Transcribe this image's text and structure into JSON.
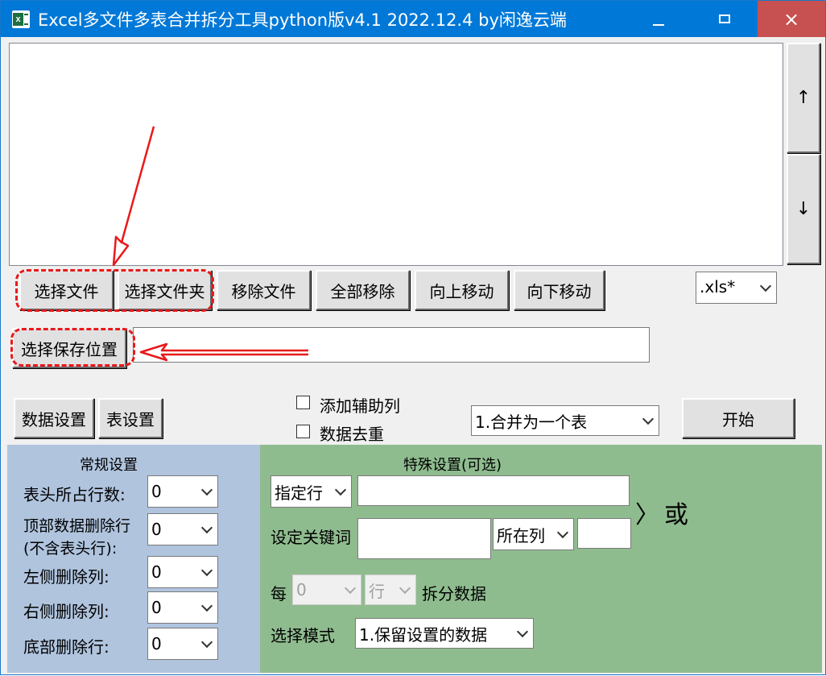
{
  "window": {
    "title": "Excel多文件多表合并拆分工具python版v4.1  2022.12.4 by闲逸云端",
    "minimize_icon": "minimize-icon",
    "maximize_icon": "maximize-icon",
    "close_icon": "close-icon",
    "close_label": "×"
  },
  "list": {
    "up_label": "↑",
    "down_label": "↓"
  },
  "toolbar": {
    "select_file": "选择文件",
    "select_folder": "选择文件夹",
    "remove_file": "移除文件",
    "remove_all": "全部移除",
    "move_up": "向上移动",
    "move_down": "向下移动",
    "ext_filter": ".xls*"
  },
  "save": {
    "select_save_location": "选择保存位置",
    "path": ""
  },
  "actions": {
    "data_settings": "数据设置",
    "sheet_settings": "表设置",
    "add_helper_column": "添加辅助列",
    "add_helper_checked": false,
    "dedupe": "数据去重",
    "dedupe_checked": false,
    "mode": "1.合并为一个表",
    "start": "开始"
  },
  "general": {
    "title": "常规设置",
    "header_rows_label": "表头所占行数:",
    "header_rows_value": "0",
    "top_delete_label1": "顶部数据删除行",
    "top_delete_label2": "(不含表头行):",
    "top_delete_value": "0",
    "left_delete_label": "左侧删除列:",
    "left_delete_value": "0",
    "right_delete_label": "右侧删除列:",
    "right_delete_value": "0",
    "bottom_delete_label": "底部删除行:",
    "bottom_delete_value": "0"
  },
  "special": {
    "title": "特殊设置(可选)",
    "row_select": "指定行",
    "row_input": "",
    "or_bracket": "〉",
    "or_label": "或",
    "keyword_label": "设定关键词",
    "keyword_input": "",
    "column_select": "所在列",
    "column_input": "",
    "every_label": "每",
    "every_value": "0",
    "unit_select": "行",
    "split_label": "拆分数据",
    "mode_label": "选择模式",
    "mode_select": "1.保留设置的数据"
  },
  "annotations": {
    "color": "#e8191b"
  }
}
